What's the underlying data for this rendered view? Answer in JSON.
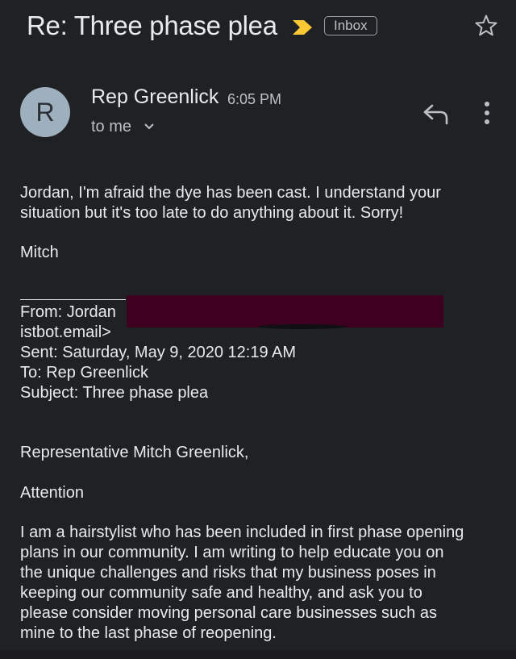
{
  "header": {
    "subject": "Re: Three phase plea",
    "label": "Inbox",
    "importance_color": "#fcc934"
  },
  "message": {
    "avatar_letter": "R",
    "avatar_color": "#9eafbd",
    "sender": "Rep Greenlick",
    "time": "6:05 PM",
    "recipient": "to me"
  },
  "body": {
    "reply_line_1": "Jordan, I'm afraid the dye has been cast.  I understand your",
    "reply_line_2": "situation but it's too late to do anything about it.  Sorry!",
    "signature": "Mitch",
    "quote": {
      "from": "From: Jordan",
      "from_cont": "istbot.email>",
      "sent": "Sent: Saturday, May 9, 2020 12:19 AM",
      "to": "To: Rep Greenlick",
      "subject": "Subject: Three phase plea"
    },
    "greeting": "Representative Mitch Greenlick,",
    "attention": "Attention",
    "para_lines": [
      "I am a hairstylist who has been included in first phase opening",
      "plans in our community. I am writing to help educate you on",
      "the unique challenges and risks that my business poses in",
      "keeping our community safe and healthy, and ask you to",
      "please consider moving personal care businesses such as",
      "mine to the last phase of reopening."
    ],
    "redaction_color": "#3d0020"
  }
}
